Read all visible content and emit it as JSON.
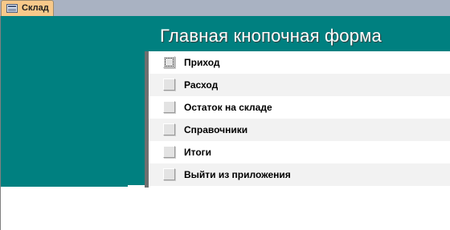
{
  "tab": {
    "label": "Склад",
    "icon": "form-icon"
  },
  "form": {
    "title": "Главная кнопочная форма",
    "header_color": "#008080",
    "items": [
      {
        "label": "Приход"
      },
      {
        "label": "Расход"
      },
      {
        "label": "Остаток на складе"
      },
      {
        "label": "Справочники"
      },
      {
        "label": "Итоги"
      },
      {
        "label": "Выйти из приложения"
      }
    ]
  }
}
